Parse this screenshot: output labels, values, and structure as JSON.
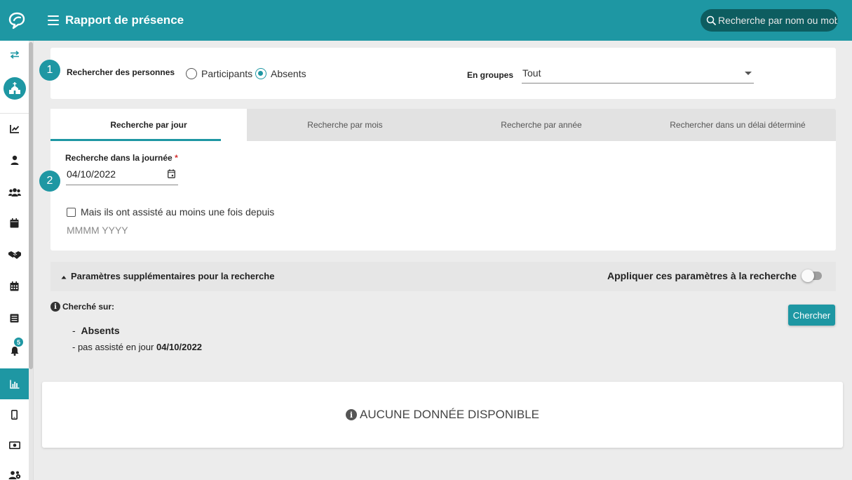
{
  "header": {
    "title": "Rapport de présence",
    "search_placeholder": "Recherche par nom ou mobile"
  },
  "sidebar": {
    "notification_count": "5",
    "items": [
      "swap-icon",
      "church-icon",
      "chart-line-icon",
      "person-icon",
      "people-group-icon",
      "calendar-icon",
      "handshake-icon",
      "calendar-grid-icon",
      "list-icon",
      "bell-icon",
      "report-chart-icon",
      "mobile-icon",
      "money-icon",
      "users-cog-icon"
    ],
    "active_item": "report-chart-icon"
  },
  "search_people": {
    "step": "1",
    "label": "Rechercher des personnes",
    "options": [
      "Participants",
      "Absents"
    ],
    "selected": "Absents",
    "groups_label": "En groupes",
    "groups_value": "Tout"
  },
  "tabs": [
    {
      "label": "Recherche par jour",
      "active": true
    },
    {
      "label": "Recherche par mois",
      "active": false
    },
    {
      "label": "Recherche par année",
      "active": false
    },
    {
      "label": "Rechercher dans un délai déterminé",
      "active": false
    }
  ],
  "day_search": {
    "step": "2",
    "label": "Recherche dans la journée",
    "required_mark": "*",
    "date_value": "04/10/2022",
    "checkbox_label": "Mais ils ont assisté au moins une fois depuis",
    "month_placeholder": "MMMM YYYY"
  },
  "params": {
    "title": "Paramètres supplémentaires pour la recherche",
    "apply_label": "Appliquer ces paramètres à la recherche"
  },
  "summary": {
    "title": "Cherché sur:",
    "line1_prefix": "-",
    "line1": "Absents",
    "line2_prefix": "- pas assisté en jour",
    "line2_date": "04/10/2022",
    "search_button": "Chercher"
  },
  "results": {
    "empty_message": "AUCUNE DONNÉE DISPONIBLE"
  },
  "colors": {
    "accent": "#1e97a3",
    "search_bg": "#0d5d60"
  }
}
